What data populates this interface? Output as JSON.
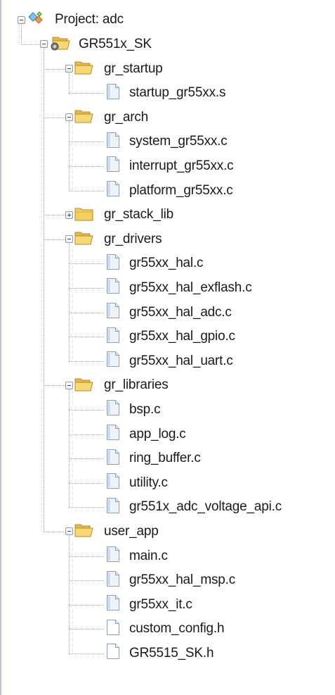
{
  "project": {
    "label": "Project: adc",
    "icon": "project-icon"
  },
  "target": {
    "label": "GR551x_SK",
    "icon": "target-folder-icon"
  },
  "groups": [
    {
      "label": "gr_startup",
      "expanded": true,
      "icon": "open-folder-icon",
      "files": [
        {
          "label": "startup_gr55xx.s",
          "icon": "file-icon"
        }
      ]
    },
    {
      "label": "gr_arch",
      "expanded": true,
      "icon": "open-folder-icon",
      "files": [
        {
          "label": "system_gr55xx.c",
          "icon": "file-icon"
        },
        {
          "label": "interrupt_gr55xx.c",
          "icon": "file-icon"
        },
        {
          "label": "platform_gr55xx.c",
          "icon": "file-icon"
        }
      ]
    },
    {
      "label": "gr_stack_lib",
      "expanded": false,
      "icon": "closed-folder-icon",
      "files": []
    },
    {
      "label": "gr_drivers",
      "expanded": true,
      "icon": "open-folder-icon",
      "files": [
        {
          "label": "gr55xx_hal.c",
          "icon": "file-icon"
        },
        {
          "label": "gr55xx_hal_exflash.c",
          "icon": "file-icon"
        },
        {
          "label": "gr55xx_hal_adc.c",
          "icon": "file-icon"
        },
        {
          "label": "gr55xx_hal_gpio.c",
          "icon": "file-icon"
        },
        {
          "label": "gr55xx_hal_uart.c",
          "icon": "file-icon"
        }
      ]
    },
    {
      "label": "gr_libraries",
      "expanded": true,
      "icon": "open-folder-icon",
      "files": [
        {
          "label": "bsp.c",
          "icon": "file-icon"
        },
        {
          "label": "app_log.c",
          "icon": "file-icon"
        },
        {
          "label": "ring_buffer.c",
          "icon": "file-icon"
        },
        {
          "label": "utility.c",
          "icon": "file-icon"
        },
        {
          "label": "gr551x_adc_voltage_api.c",
          "icon": "file-icon"
        }
      ]
    },
    {
      "label": "user_app",
      "expanded": true,
      "icon": "open-folder-icon",
      "files": [
        {
          "label": "main.c",
          "icon": "file-icon"
        },
        {
          "label": "gr55xx_hal_msp.c",
          "icon": "file-icon"
        },
        {
          "label": "gr55xx_it.c",
          "icon": "file-icon"
        },
        {
          "label": "custom_config.h",
          "icon": "header-file-icon"
        },
        {
          "label": "GR5515_SK.h",
          "icon": "header-file-icon"
        }
      ]
    }
  ]
}
